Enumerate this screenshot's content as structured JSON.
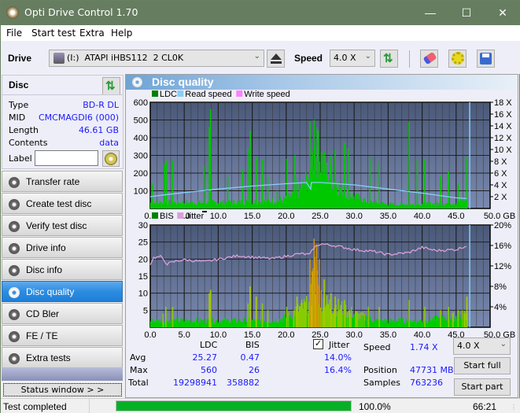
{
  "window": {
    "title": "Opti Drive Control 1.70",
    "minimize": "—",
    "maximize": "☐",
    "close": "✕"
  },
  "menu": [
    "File",
    "Start test",
    "Extra",
    "Help"
  ],
  "toolbar": {
    "drive_label": "Drive",
    "drive_value": "(I:)  ATAPI iHBS112  2 CL0K",
    "speed_label": "Speed",
    "speed_value": "4.0 X"
  },
  "disc": {
    "header": "Disc",
    "rows": [
      {
        "label": "Type",
        "value": "BD-R DL"
      },
      {
        "label": "MID",
        "value": "CMCMAGDI6 (000)"
      },
      {
        "label": "Length",
        "value": "46.61 GB"
      },
      {
        "label": "Contents",
        "value": "data"
      }
    ],
    "label_field_label": "Label",
    "label_field_value": ""
  },
  "nav": [
    {
      "label": "Transfer rate",
      "active": false
    },
    {
      "label": "Create test disc",
      "active": false
    },
    {
      "label": "Verify test disc",
      "active": false
    },
    {
      "label": "Drive info",
      "active": false
    },
    {
      "label": "Disc info",
      "active": false
    },
    {
      "label": "Disc quality",
      "active": true
    },
    {
      "label": "CD Bler",
      "active": false
    },
    {
      "label": "FE / TE",
      "active": false
    },
    {
      "label": "Extra tests",
      "active": false
    }
  ],
  "status_window_button": "Status window > >",
  "panel_title": "Disc quality",
  "chart_data": [
    {
      "type": "bar",
      "title": "LDC",
      "legend": [
        "LDC",
        "Read speed",
        "Write speed"
      ],
      "legend_colors": {
        "LDC": "#008000",
        "Read speed": "#87cefa",
        "Write speed": "#ff80ff"
      },
      "xlabel": "GB",
      "x_ticks": [
        "0.0",
        "5.0",
        "10.0",
        "15.0",
        "20.0",
        "25.0",
        "30.0",
        "35.0",
        "40.0",
        "45.0",
        "50.0 GB"
      ],
      "y_ticks_left": [
        "100",
        "200",
        "300",
        "400",
        "500",
        "600"
      ],
      "y_ticks_right": [
        "2 X",
        "4 X",
        "6 X",
        "8 X",
        "10 X",
        "12 X",
        "14 X",
        "16 X",
        "18 X"
      ],
      "xlim": [
        0,
        50
      ],
      "ylim": [
        0,
        600
      ],
      "y2lim": [
        0,
        18
      ],
      "ldc_spikes": [
        [
          0.2,
          140
        ],
        [
          2.0,
          250
        ],
        [
          2.3,
          270
        ],
        [
          3.2,
          270
        ],
        [
          7.8,
          240
        ],
        [
          8.6,
          460
        ],
        [
          8.8,
          560
        ],
        [
          11.3,
          180
        ],
        [
          13.5,
          220
        ],
        [
          14.3,
          340
        ],
        [
          14.6,
          440
        ],
        [
          15.5,
          290
        ],
        [
          16.4,
          280
        ],
        [
          17.2,
          180
        ],
        [
          18.6,
          100
        ],
        [
          20.0,
          280
        ],
        [
          21.2,
          300
        ],
        [
          21.5,
          170
        ],
        [
          23.4,
          490
        ],
        [
          24.0,
          500
        ],
        [
          24.6,
          440
        ],
        [
          26.5,
          300
        ],
        [
          27.1,
          330
        ],
        [
          28.5,
          370
        ],
        [
          29.0,
          340
        ],
        [
          32.2,
          290
        ],
        [
          33.6,
          260
        ],
        [
          38.0,
          490
        ],
        [
          39.2,
          280
        ],
        [
          40.3,
          280
        ],
        [
          42.6,
          180
        ],
        [
          43.8,
          210
        ],
        [
          45.2,
          140
        ],
        [
          46.5,
          290
        ]
      ],
      "ldc_base": [
        [
          0,
          35
        ],
        [
          5,
          35
        ],
        [
          10,
          35
        ],
        [
          15,
          40
        ],
        [
          18,
          45
        ],
        [
          20,
          55
        ],
        [
          22,
          110
        ],
        [
          23.5,
          200
        ],
        [
          24,
          370
        ],
        [
          25,
          300
        ],
        [
          26,
          200
        ],
        [
          27,
          160
        ],
        [
          28,
          120
        ],
        [
          30,
          70
        ],
        [
          32,
          40
        ],
        [
          35,
          25
        ],
        [
          40,
          25
        ],
        [
          45,
          35
        ],
        [
          46.6,
          60
        ]
      ],
      "read_speed": [
        [
          0,
          2.0
        ],
        [
          2,
          2.3
        ],
        [
          5,
          2.7
        ],
        [
          10,
          3.3
        ],
        [
          15,
          3.8
        ],
        [
          20,
          4.2
        ],
        [
          23,
          4.4
        ],
        [
          23.6,
          3.3
        ],
        [
          23.7,
          4.4
        ],
        [
          25,
          4.4
        ],
        [
          30,
          4.0
        ],
        [
          35,
          3.3
        ],
        [
          40,
          2.6
        ],
        [
          45,
          1.8
        ],
        [
          46.6,
          1.7
        ]
      ],
      "end_marker_gb": 47.0
    },
    {
      "type": "bar",
      "title": "BIS",
      "legend": [
        "BIS",
        "Jitter"
      ],
      "legend_colors": {
        "BIS": "#008000",
        "Jitter": "#d8a0d8"
      },
      "xlabel": "GB",
      "x_ticks": [
        "0.0",
        "5.0",
        "10.0",
        "15.0",
        "20.0",
        "25.0",
        "30.0",
        "35.0",
        "40.0",
        "45.0",
        "50.0 GB"
      ],
      "y_ticks_left": [
        "5",
        "10",
        "15",
        "20",
        "25",
        "30"
      ],
      "y_ticks_right": [
        "4%",
        "8%",
        "12%",
        "16%",
        "20%"
      ],
      "xlim": [
        0,
        50
      ],
      "ylim": [
        0,
        30
      ],
      "y2lim": [
        0,
        20
      ],
      "bis_spikes": [
        [
          1.8,
          4
        ],
        [
          2.2,
          6
        ],
        [
          3.2,
          6
        ],
        [
          8.6,
          10
        ],
        [
          8.8,
          11
        ],
        [
          14.3,
          7
        ],
        [
          14.6,
          12
        ],
        [
          15.5,
          9
        ],
        [
          16.4,
          7
        ],
        [
          17.2,
          5
        ],
        [
          20.0,
          6
        ],
        [
          21.5,
          9
        ],
        [
          23.4,
          20
        ],
        [
          24.0,
          26
        ],
        [
          24.4,
          24
        ],
        [
          24.8,
          20
        ],
        [
          25.5,
          14
        ],
        [
          26.5,
          10
        ],
        [
          27.1,
          9
        ],
        [
          28.5,
          8
        ],
        [
          32.0,
          6
        ],
        [
          33.6,
          6
        ],
        [
          38.0,
          8
        ],
        [
          40.3,
          6
        ],
        [
          42.6,
          5
        ],
        [
          43.8,
          6
        ],
        [
          45.2,
          5
        ],
        [
          46.5,
          9
        ]
      ],
      "bis_base": [
        [
          0,
          2
        ],
        [
          10,
          2
        ],
        [
          18,
          2
        ],
        [
          20,
          3
        ],
        [
          22,
          6
        ],
        [
          23.4,
          7
        ],
        [
          24,
          18
        ],
        [
          25,
          9
        ],
        [
          26,
          7
        ],
        [
          28,
          6
        ],
        [
          30,
          4
        ],
        [
          33,
          2
        ],
        [
          40,
          2
        ],
        [
          44,
          3
        ],
        [
          46.6,
          4
        ]
      ],
      "jitter": [
        [
          0,
          12.4
        ],
        [
          0.5,
          13.6
        ],
        [
          1.5,
          13.8
        ],
        [
          2.5,
          12.4
        ],
        [
          4,
          13.0
        ],
        [
          5,
          13.2
        ],
        [
          8,
          12.8
        ],
        [
          10,
          13.3
        ],
        [
          13,
          14.0
        ],
        [
          15,
          13.7
        ],
        [
          18,
          13.4
        ],
        [
          20,
          13.9
        ],
        [
          22,
          14.4
        ],
        [
          23.5,
          14.2
        ],
        [
          24,
          15.5
        ],
        [
          25,
          16.3
        ],
        [
          27,
          16.0
        ],
        [
          30,
          15.2
        ],
        [
          33,
          14.8
        ],
        [
          35,
          14.2
        ],
        [
          38,
          14.6
        ],
        [
          40,
          15.6
        ],
        [
          42,
          15.0
        ],
        [
          45,
          15.2
        ],
        [
          46.6,
          16.0
        ]
      ],
      "end_marker_gb": 47.0
    }
  ],
  "stats": {
    "headers": [
      "LDC",
      "BIS"
    ],
    "rows": [
      {
        "label": "Avg",
        "ldc": "25.27",
        "bis": "0.47",
        "jitter": "14.0%"
      },
      {
        "label": "Max",
        "ldc": "560",
        "bis": "26",
        "jitter": "16.4%"
      },
      {
        "label": "Total",
        "ldc": "19298941",
        "bis": "358882"
      }
    ],
    "jitter_label": "Jitter",
    "jitter_checked": true,
    "speed_label": "Speed",
    "speed_value": "1.74 X",
    "position_label": "Position",
    "position_value": "47731 MB",
    "samples_label": "Samples",
    "samples_value": "763236",
    "speed_select": "4.0 X",
    "start_full": "Start full",
    "start_part": "Start part"
  },
  "status": {
    "text": "Test completed",
    "progress": 100.0,
    "progress_label": "100.0%",
    "time": "66:21"
  }
}
